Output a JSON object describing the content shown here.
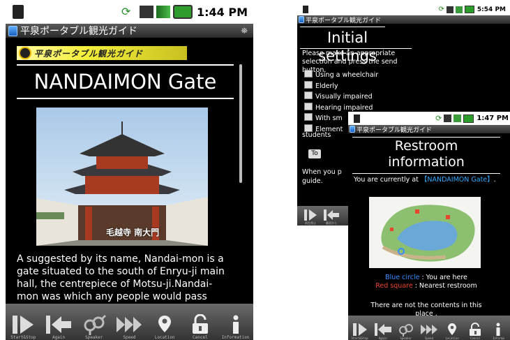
{
  "phone_main": {
    "status_time": "1:44 PM",
    "app_title": "平泉ポータブル観光ガイド",
    "banner_text": "平泉ポータブル観光ガイド",
    "heading": "NANDAIMON Gate",
    "photo_caption": "毛越寺 南大門",
    "body_text": "A suggested by its name, Nandai-mon is a gate situated to the south of Enryu-ji main hall, the centrepiece of Motsu-ji.Nandai-mon was which any people would pass through as an exit and entrance to Hiraizumi. The walls are thought to have been painted white and the roof and columns painted red.",
    "toolbar": [
      "Start&Stop",
      "Again",
      "Speaker",
      "Speed",
      "Location",
      "Cancel",
      "Information"
    ]
  },
  "phone_settings": {
    "status_time": "5:54 PM",
    "app_title": "平泉ポータブル観光ガイド",
    "heading": "Initial settings",
    "instruction": "Please make an appropriate selection and press the send button.",
    "options": [
      "Using a wheelchair",
      "Elderly",
      "Visually impaired",
      "Hearing impaired",
      "With sm",
      "Element"
    ],
    "students_text": "students",
    "to_button": "To",
    "footer_text_1": "When you p",
    "footer_text_2": "guide.",
    "toolbar": [
      "再生停止",
      "最初から"
    ]
  },
  "phone_restroom": {
    "status_time": "1:47 PM",
    "app_title": "平泉ポータブル観光ガイド",
    "heading_line1": "Restroom",
    "heading_line2": "information",
    "current_prefix": "You are currently at",
    "current_location": "【NANDAIMON Gate】",
    "current_suffix": ".",
    "legend_blue_key": "Blue circle",
    "legend_blue_desc": " : You are here",
    "legend_red_key": "Red square",
    "legend_red_desc": " : Nearest restroom",
    "no_contents_1": "There are not the contents in this",
    "no_contents_2": "place .",
    "toolbar": [
      "Start&Stop",
      "Again",
      "Speaker",
      "Speed",
      "Location",
      "Cancel",
      "Informa"
    ]
  },
  "colors": {
    "accent_blue": "#33aaff",
    "legend_blue": "#3a8cff",
    "legend_red": "#e8462c",
    "banner_yellow": "#f4ef3c"
  }
}
